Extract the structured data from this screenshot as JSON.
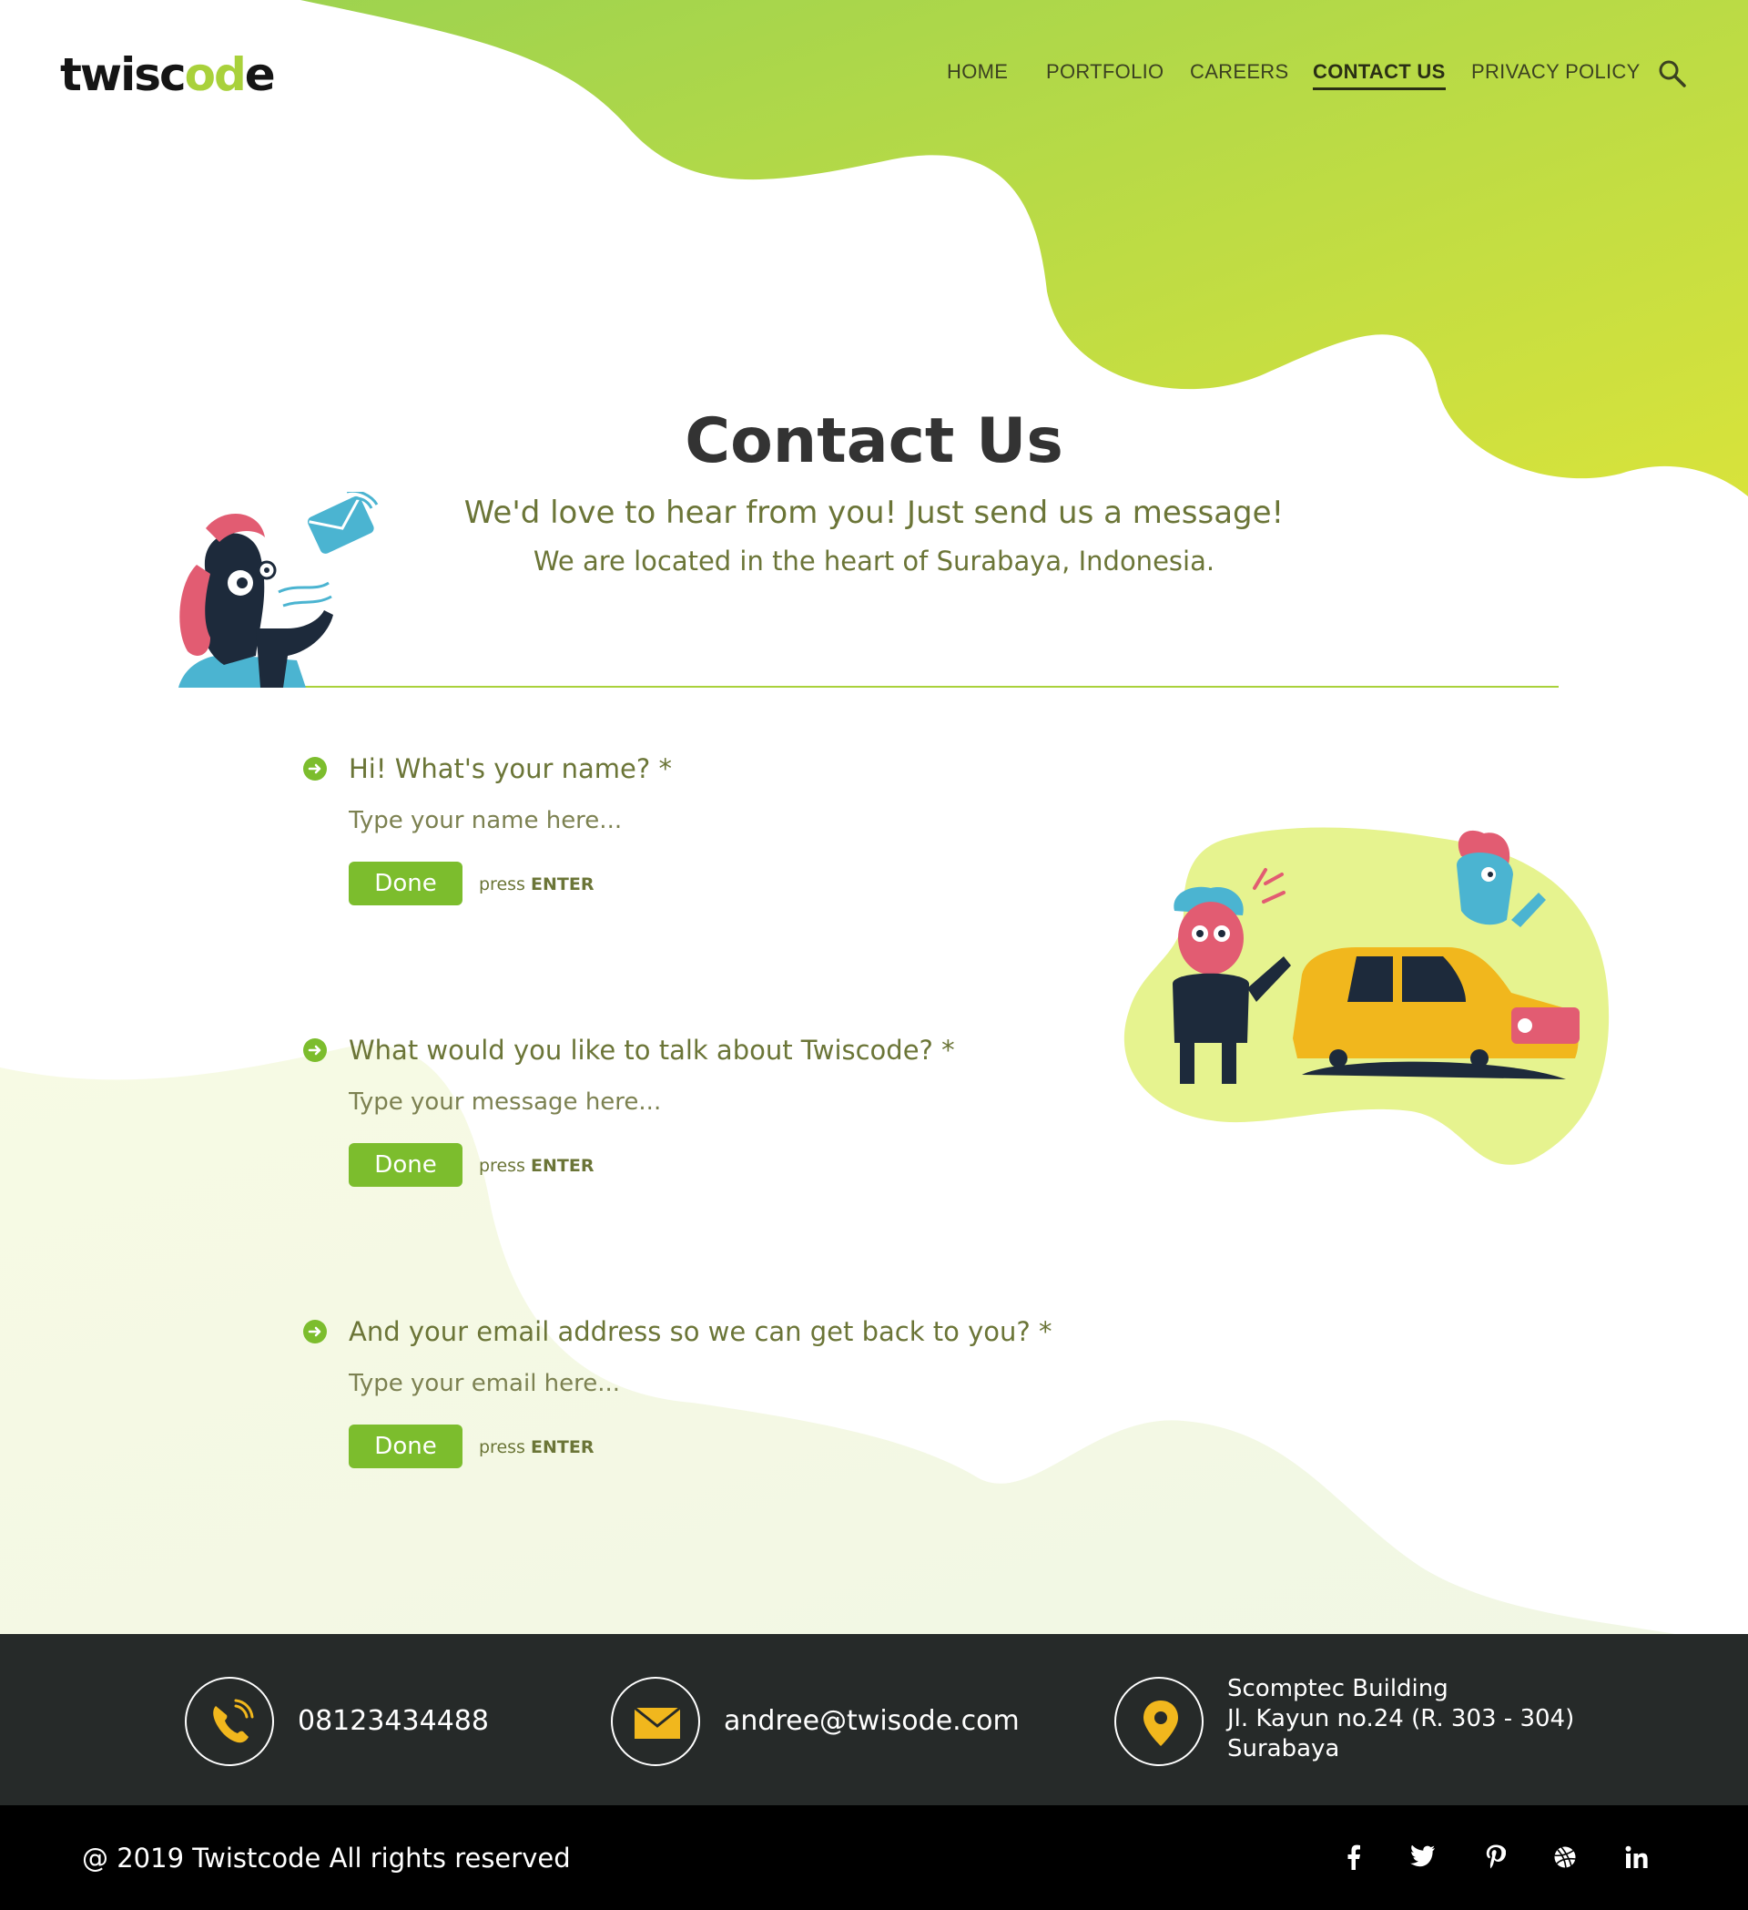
{
  "logo": {
    "prefix": "twisc",
    "accent": "od",
    "suffix": "e"
  },
  "nav": {
    "items": [
      {
        "label": "HOME"
      },
      {
        "label": "PORTFOLIO"
      },
      {
        "label": "CAREERS"
      },
      {
        "label": "CONTACT US"
      },
      {
        "label": "PRIVACY POLICY"
      }
    ],
    "active": "CONTACT US",
    "search_icon": "search-icon"
  },
  "hero": {
    "title": "Contact Us",
    "subtitle_1": "We'd love to hear from you! Just send us a message!",
    "subtitle_2": "We are located in the heart of Surabaya, Indonesia."
  },
  "form": {
    "questions": [
      {
        "label": "Hi! What's your name? *",
        "placeholder": "Type your name here...",
        "button": "Done",
        "hint_prefix": "press",
        "hint_key": "ENTER"
      },
      {
        "label": "What would you like to talk about Twiscode? *",
        "placeholder": "Type your message here...",
        "button": "Done",
        "hint_prefix": "press",
        "hint_key": "ENTER"
      },
      {
        "label": "And your email address so we can get back to you? *",
        "placeholder": "Type your email here...",
        "button": "Done",
        "hint_prefix": "press",
        "hint_key": "ENTER"
      }
    ]
  },
  "contact": {
    "phone": "08123434488",
    "email": "andree@twisode.com",
    "address": [
      "Scomptec Building",
      "Jl. Kayun no.24 (R. 303 - 304)",
      "Surabaya"
    ],
    "icons": [
      "phone-icon",
      "mail-icon",
      "location-pin-icon"
    ]
  },
  "footer": {
    "copyright": "@ 2019 Twistcode All rights reserved",
    "social_icons": [
      "facebook-icon",
      "twitter-icon",
      "pinterest-icon",
      "dribbble-icon",
      "linkedin-icon"
    ]
  },
  "colors": {
    "brand_green": "#a9d13b",
    "button_green": "#7cbd2d",
    "text_olive": "#6b7537",
    "contact_bar": "#262a29",
    "footer_bg": "#000000",
    "icon_yellow": "#f1b71d"
  }
}
